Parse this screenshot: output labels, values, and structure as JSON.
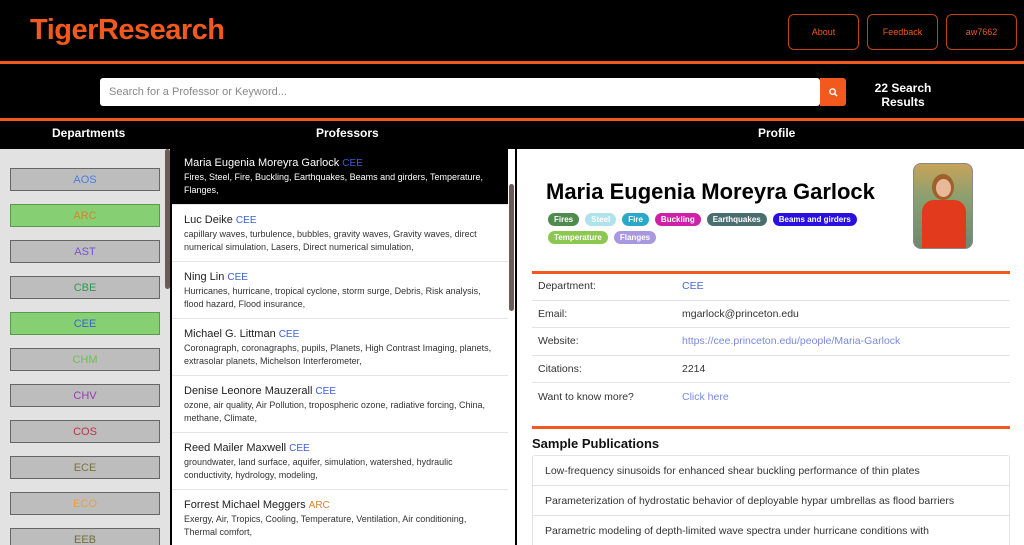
{
  "header": {
    "logo": "TigerResearch",
    "nav": [
      "About",
      "Feedback",
      "aw7662"
    ]
  },
  "search": {
    "placeholder": "Search for a Professor or Keyword...",
    "value": "",
    "results_count": "22 Search",
    "results_label": "Results",
    "icon": "search-icon"
  },
  "columns": {
    "departments": "Departments",
    "professors": "Professors",
    "profile": "Profile"
  },
  "departments": [
    {
      "code": "AOS",
      "color": "#4a7fe0",
      "selected": false
    },
    {
      "code": "ARC",
      "color": "#d9822b",
      "selected": true
    },
    {
      "code": "AST",
      "color": "#7a4fd0",
      "selected": false
    },
    {
      "code": "CBE",
      "color": "#2e9a4a",
      "selected": false
    },
    {
      "code": "CEE",
      "color": "#3a5fd8",
      "selected": true
    },
    {
      "code": "CHM",
      "color": "#6cc050",
      "selected": false
    },
    {
      "code": "CHV",
      "color": "#9a3ab8",
      "selected": false
    },
    {
      "code": "COS",
      "color": "#c0304a",
      "selected": false
    },
    {
      "code": "ECE",
      "color": "#7a7040",
      "selected": false
    },
    {
      "code": "ECO",
      "color": "#e8a040",
      "selected": false
    },
    {
      "code": "EEB",
      "color": "#707030",
      "selected": false
    }
  ],
  "professors": [
    {
      "name": "Maria Eugenia Moreyra Garlock",
      "dept": "CEE",
      "dept_color": "#3a5fd8",
      "keywords": "Fires, Steel, Fire, Buckling, Earthquakes, Beams and girders, Temperature, Flanges,"
    },
    {
      "name": "Luc Deike",
      "dept": "CEE",
      "dept_color": "#3a5fd8",
      "keywords": "capillary waves, turbulence, bubbles, gravity waves, Gravity waves, direct numerical simulation, Lasers, Direct numerical simulation,"
    },
    {
      "name": "Ning Lin",
      "dept": "CEE",
      "dept_color": "#3a5fd8",
      "keywords": "Hurricanes, hurricane, tropical cyclone, storm surge, Debris, Risk analysis, flood hazard, Flood insurance,"
    },
    {
      "name": "Michael G. Littman",
      "dept": "CEE",
      "dept_color": "#3a5fd8",
      "keywords": "Coronagraph, coronagraphs, pupils, Planets, High Contrast Imaging, planets, extrasolar planets, Michelson Interferometer,"
    },
    {
      "name": "Denise Leonore Mauzerall",
      "dept": "CEE",
      "dept_color": "#3a5fd8",
      "keywords": "ozone, air quality, Air Pollution, tropospheric ozone, radiative forcing, China, methane, Climate,"
    },
    {
      "name": "Reed Mailer Maxwell",
      "dept": "CEE",
      "dept_color": "#3a5fd8",
      "keywords": "groundwater, land surface, aquifer, simulation, watershed, hydraulic conductivity, hydrology, modeling,"
    },
    {
      "name": "Forrest Michael Meggers",
      "dept": "ARC",
      "dept_color": "#d9822b",
      "keywords": "Exergy, Air, Tropics, Cooling, Temperature, Ventilation, Air conditioning, Thermal comfort,"
    }
  ],
  "profile": {
    "name": "Maria Eugenia Moreyra Garlock",
    "tags": [
      {
        "label": "Fires",
        "color": "#4f8a4f"
      },
      {
        "label": "Steel",
        "color": "#b0e2ec"
      },
      {
        "label": "Fire",
        "color": "#2aa8c8"
      },
      {
        "label": "Buckling",
        "color": "#d020a8"
      },
      {
        "label": "Earthquakes",
        "color": "#4a6e70"
      },
      {
        "label": "Beams and girders",
        "color": "#2a10e0"
      },
      {
        "label": "Temperature",
        "color": "#8cc850"
      },
      {
        "label": "Flanges",
        "color": "#a898e0"
      }
    ],
    "info": [
      {
        "label": "Department:",
        "value": "CEE"
      },
      {
        "label": "Email:",
        "value": "mgarlock@princeton.edu"
      },
      {
        "label": "Website:",
        "value": "https://cee.princeton.edu/people/Maria-Garlock"
      },
      {
        "label": "Citations:",
        "value": "2214"
      },
      {
        "label": "Want to know more?",
        "value": "Click here"
      }
    ],
    "publications_title": "Sample Publications",
    "publications": [
      "Low-frequency sinusoids for enhanced shear buckling performance of thin plates",
      "Parameterization of hydrostatic behavior of deployable hypar umbrellas as flood barriers",
      "Parametric modeling of depth-limited wave spectra under hurricane conditions with"
    ]
  }
}
